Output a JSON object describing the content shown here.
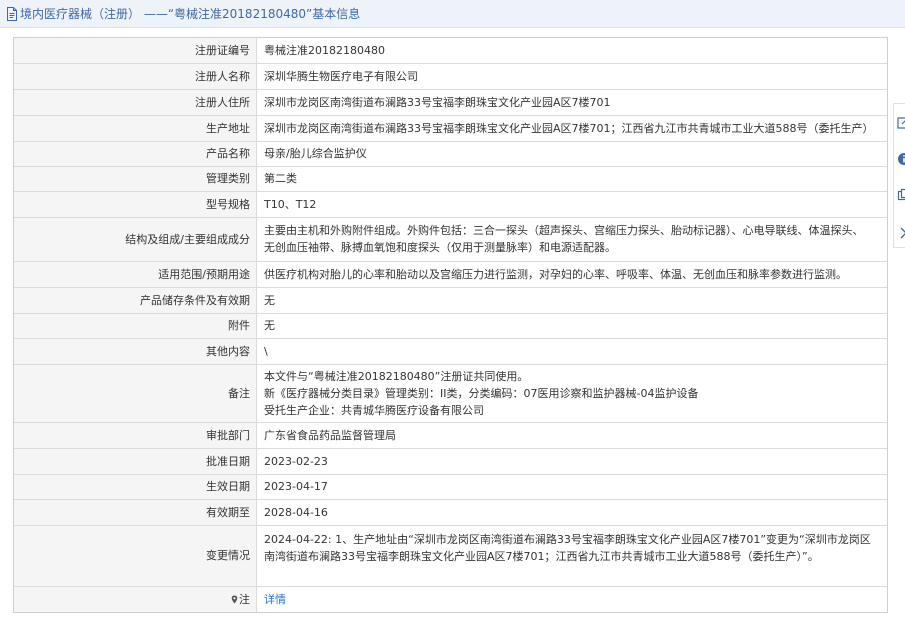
{
  "header": {
    "title": "境内医疗器械（注册） ——“粤械注准20182180480”基本信息"
  },
  "rows": [
    {
      "label": "注册证编号",
      "value": "粤械注准20182180480"
    },
    {
      "label": "注册人名称",
      "value": "深圳华腾生物医疗电子有限公司"
    },
    {
      "label": "注册人住所",
      "value": "深圳市龙岗区南湾街道布澜路33号宝福李朗珠宝文化产业园A区7楼701"
    },
    {
      "label": "生产地址",
      "value": "深圳市龙岗区南湾街道布澜路33号宝福李朗珠宝文化产业园A区7楼701；江西省九江市共青城市工业大道588号（委托生产）"
    },
    {
      "label": "产品名称",
      "value": "母亲/胎儿综合监护仪"
    },
    {
      "label": "管理类别",
      "value": "第二类"
    },
    {
      "label": "型号规格",
      "value": "T10、T12"
    },
    {
      "label": "结构及组成/主要组成成分",
      "value": "主要由主机和外购附件组成。外购件包括：三合一探头（超声探头、宫缩压力探头、胎动标记器）、心电导联线、体温探头、无创血压袖带、脉搏血氧饱和度探头（仅用于测量脉率）和电源适配器。"
    },
    {
      "label": "适用范围/预期用途",
      "value": "供医疗机构对胎儿的心率和胎动以及宫缩压力进行监测，对孕妇的心率、呼吸率、体温、无创血压和脉率参数进行监测。"
    },
    {
      "label": "产品储存条件及有效期",
      "value": "无"
    },
    {
      "label": "附件",
      "value": "无"
    },
    {
      "label": "其他内容",
      "value": "\\"
    }
  ],
  "remarks": {
    "label": "备注",
    "lines": [
      "本文件与“粤械注准20182180480”注册证共同使用。",
      "新《医疗器械分类目录》管理类别：II类，分类编码：07医用诊察和监护器械-04监护设备",
      "受托生产企业：共青城华腾医疗设备有限公司"
    ]
  },
  "rows2": [
    {
      "label": "审批部门",
      "value": "广东省食品药品监督管理局"
    },
    {
      "label": "批准日期",
      "value": "2023-02-23"
    },
    {
      "label": "生效日期",
      "value": "2023-04-17"
    },
    {
      "label": "有效期至",
      "value": "2028-04-16"
    }
  ],
  "changes": {
    "label": "变更情况",
    "value": "2024-04-22: 1、生产地址由“深圳市龙岗区南湾街道布澜路33号宝福李朗珠宝文化产业园A区7楼701”变更为“深圳市龙岗区南湾街道布澜路33号宝福李朗珠宝文化产业园A区7楼701；江西省九江市共青城市工业大道588号（委托生产）”。"
  },
  "note": {
    "label": "注",
    "icon": "location-pin-icon",
    "link_text": "详情"
  },
  "side_tools": [
    "edit-icon",
    "info-icon",
    "copy-icon",
    "chevron-right-icon"
  ],
  "colors": {
    "header_text": "#3f6aa1",
    "header_bg": "#eef3f9",
    "label_bg": "#f5f5f5",
    "link": "#2a72c8"
  }
}
